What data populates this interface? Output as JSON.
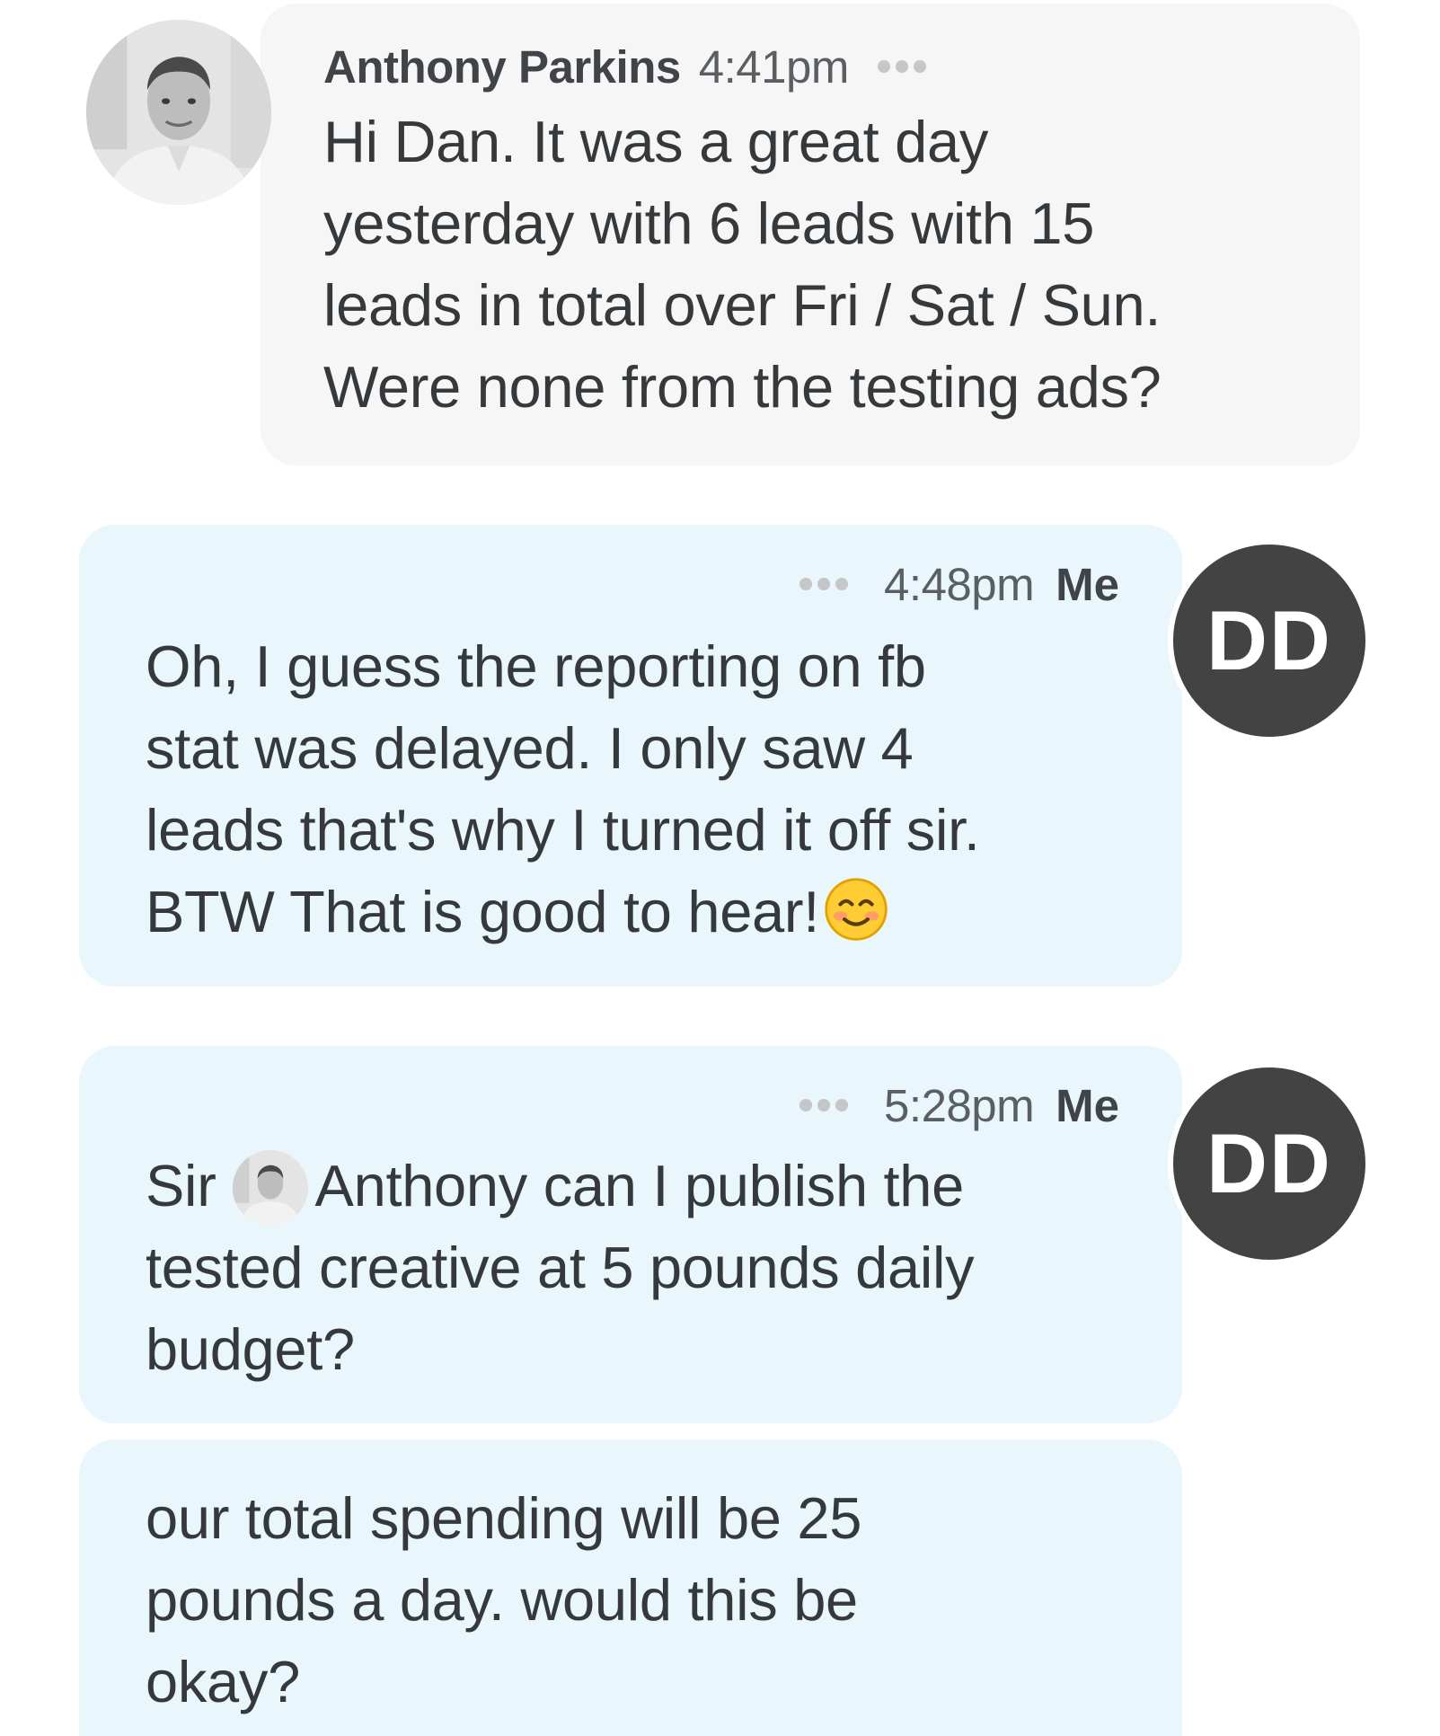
{
  "messages": [
    {
      "direction": "incoming",
      "sender": "Anthony Parkins",
      "time": "4:41pm",
      "lines": [
        "Hi Dan. It was a great day",
        "yesterday with 6 leads with 15",
        "leads in total over Fri / Sat / Sun.",
        "Were none from the testing ads?"
      ]
    },
    {
      "direction": "outgoing",
      "sender": "Me",
      "time": "4:48pm",
      "avatar_initials": "DD",
      "lines": [
        "Oh, I guess the reporting on fb",
        "stat was delayed. I only saw 4",
        "leads that's why I turned it off sir.",
        "BTW That is good to hear!"
      ],
      "emoji": "smiling-face-emoji"
    },
    {
      "direction": "outgoing",
      "sender": "Me",
      "time": "5:28pm",
      "avatar_initials": "DD",
      "mention_prefix": "Sir",
      "mention_name": "Anthony",
      "lines": [
        "can I publish the",
        "tested creative at 5 pounds daily",
        "budget?"
      ]
    },
    {
      "direction": "outgoing",
      "lines": [
        "our total spending will be 25",
        "pounds a day. would this be",
        "okay?"
      ]
    }
  ],
  "colors": {
    "incoming_bubble": "#f6f6f6",
    "outgoing_bubble": "#e9f6fc",
    "avatar_dd_bg": "#434343",
    "text": "#35393c",
    "dots": "#c4c6c8"
  }
}
